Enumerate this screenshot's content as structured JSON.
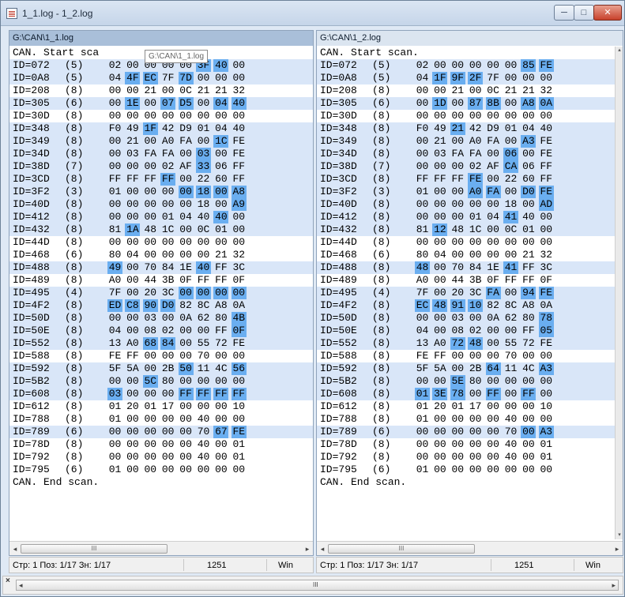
{
  "window": {
    "title": "1_1.log - 1_2.log"
  },
  "window_buttons": {
    "min": "─",
    "max": "□",
    "close": "✕"
  },
  "tooltip": "G:\\CAN\\1_1.log",
  "left": {
    "path": "G:\\CAN\\1_1.log",
    "start": "CAN. Start sca",
    "end": "CAN. End scan.",
    "rows": [
      {
        "id": "ID=072",
        "dlc": "(5)",
        "bytes": [
          "02",
          "00",
          "00",
          "00",
          "00",
          "3F",
          "40",
          "00"
        ],
        "diff": [
          5,
          6
        ],
        "hl": true
      },
      {
        "id": "ID=0A8",
        "dlc": "(5)",
        "bytes": [
          "04",
          "4F",
          "EC",
          "7F",
          "7D",
          "00",
          "00",
          "00"
        ],
        "diff": [
          1,
          2,
          4
        ],
        "hl": true
      },
      {
        "id": "ID=208",
        "dlc": "(8)",
        "bytes": [
          "00",
          "00",
          "21",
          "00",
          "0C",
          "21",
          "21",
          "32"
        ],
        "diff": [],
        "hl": false
      },
      {
        "id": "ID=305",
        "dlc": "(6)",
        "bytes": [
          "00",
          "1E",
          "00",
          "07",
          "D5",
          "00",
          "04",
          "40"
        ],
        "diff": [
          1,
          3,
          4,
          6,
          7
        ],
        "hl": true
      },
      {
        "id": "ID=30D",
        "dlc": "(8)",
        "bytes": [
          "00",
          "00",
          "00",
          "00",
          "00",
          "00",
          "00",
          "00"
        ],
        "diff": [],
        "hl": false
      },
      {
        "id": "ID=348",
        "dlc": "(8)",
        "bytes": [
          "F0",
          "49",
          "1F",
          "42",
          "D9",
          "01",
          "04",
          "40"
        ],
        "diff": [
          2
        ],
        "hl": true
      },
      {
        "id": "ID=349",
        "dlc": "(8)",
        "bytes": [
          "00",
          "21",
          "00",
          "A0",
          "FA",
          "00",
          "1C",
          "FE"
        ],
        "diff": [
          6
        ],
        "hl": true
      },
      {
        "id": "ID=34D",
        "dlc": "(8)",
        "bytes": [
          "00",
          "03",
          "FA",
          "FA",
          "00",
          "03",
          "00",
          "FE"
        ],
        "diff": [
          5
        ],
        "hl": true
      },
      {
        "id": "ID=38D",
        "dlc": "(7)",
        "bytes": [
          "00",
          "00",
          "00",
          "02",
          "AF",
          "33",
          "06",
          "FF"
        ],
        "diff": [
          5
        ],
        "hl": true
      },
      {
        "id": "ID=3CD",
        "dlc": "(8)",
        "bytes": [
          "FF",
          "FF",
          "FF",
          "FF",
          "00",
          "22",
          "60",
          "FF"
        ],
        "diff": [
          3
        ],
        "hl": true
      },
      {
        "id": "ID=3F2",
        "dlc": "(3)",
        "bytes": [
          "01",
          "00",
          "00",
          "00",
          "00",
          "18",
          "00",
          "A8"
        ],
        "diff": [
          4,
          5,
          6,
          7
        ],
        "hl": true
      },
      {
        "id": "ID=40D",
        "dlc": "(8)",
        "bytes": [
          "00",
          "00",
          "00",
          "00",
          "00",
          "18",
          "00",
          "A9"
        ],
        "diff": [
          7
        ],
        "hl": true
      },
      {
        "id": "ID=412",
        "dlc": "(8)",
        "bytes": [
          "00",
          "00",
          "00",
          "01",
          "04",
          "40",
          "40",
          "00"
        ],
        "diff": [
          6
        ],
        "hl": true
      },
      {
        "id": "ID=432",
        "dlc": "(8)",
        "bytes": [
          "81",
          "1A",
          "48",
          "1C",
          "00",
          "0C",
          "01",
          "00"
        ],
        "diff": [
          1
        ],
        "hl": true
      },
      {
        "id": "ID=44D",
        "dlc": "(8)",
        "bytes": [
          "00",
          "00",
          "00",
          "00",
          "00",
          "00",
          "00",
          "00"
        ],
        "diff": [],
        "hl": false
      },
      {
        "id": "ID=468",
        "dlc": "(6)",
        "bytes": [
          "80",
          "04",
          "00",
          "00",
          "00",
          "00",
          "21",
          "32"
        ],
        "diff": [],
        "hl": false
      },
      {
        "id": "ID=488",
        "dlc": "(8)",
        "bytes": [
          "49",
          "00",
          "70",
          "84",
          "1E",
          "40",
          "FF",
          "3C"
        ],
        "diff": [
          0,
          5
        ],
        "hl": true
      },
      {
        "id": "ID=489",
        "dlc": "(8)",
        "bytes": [
          "A0",
          "00",
          "44",
          "3B",
          "0F",
          "FF",
          "FF",
          "0F"
        ],
        "diff": [],
        "hl": false
      },
      {
        "id": "ID=495",
        "dlc": "(4)",
        "bytes": [
          "7F",
          "00",
          "20",
          "3C",
          "00",
          "00",
          "00",
          "00"
        ],
        "diff": [
          4,
          5,
          6,
          7
        ],
        "hl": true
      },
      {
        "id": "ID=4F2",
        "dlc": "(8)",
        "bytes": [
          "ED",
          "C8",
          "90",
          "D0",
          "82",
          "8C",
          "A8",
          "0A"
        ],
        "diff": [
          0,
          1,
          2,
          3
        ],
        "hl": true
      },
      {
        "id": "ID=50D",
        "dlc": "(8)",
        "bytes": [
          "00",
          "00",
          "03",
          "00",
          "0A",
          "62",
          "80",
          "4B"
        ],
        "diff": [
          7
        ],
        "hl": true
      },
      {
        "id": "ID=50E",
        "dlc": "(8)",
        "bytes": [
          "04",
          "00",
          "08",
          "02",
          "00",
          "00",
          "FF",
          "0F"
        ],
        "diff": [
          7
        ],
        "hl": true
      },
      {
        "id": "ID=552",
        "dlc": "(8)",
        "bytes": [
          "13",
          "A0",
          "68",
          "84",
          "00",
          "55",
          "72",
          "FE"
        ],
        "diff": [
          2,
          3
        ],
        "hl": true
      },
      {
        "id": "ID=588",
        "dlc": "(8)",
        "bytes": [
          "FE",
          "FF",
          "00",
          "00",
          "00",
          "70",
          "00",
          "00"
        ],
        "diff": [],
        "hl": false
      },
      {
        "id": "ID=592",
        "dlc": "(8)",
        "bytes": [
          "5F",
          "5A",
          "00",
          "2B",
          "50",
          "11",
          "4C",
          "56"
        ],
        "diff": [
          4,
          7
        ],
        "hl": true
      },
      {
        "id": "ID=5B2",
        "dlc": "(8)",
        "bytes": [
          "00",
          "00",
          "5C",
          "80",
          "00",
          "00",
          "00",
          "00"
        ],
        "diff": [
          2
        ],
        "hl": true
      },
      {
        "id": "ID=608",
        "dlc": "(8)",
        "bytes": [
          "03",
          "00",
          "00",
          "00",
          "FF",
          "FF",
          "FF",
          "FF"
        ],
        "diff": [
          0,
          4,
          5,
          6,
          7
        ],
        "hl": true
      },
      {
        "id": "ID=612",
        "dlc": "(8)",
        "bytes": [
          "01",
          "20",
          "01",
          "17",
          "00",
          "00",
          "00",
          "10"
        ],
        "diff": [],
        "hl": false
      },
      {
        "id": "ID=788",
        "dlc": "(8)",
        "bytes": [
          "01",
          "00",
          "00",
          "00",
          "00",
          "40",
          "00",
          "00"
        ],
        "diff": [],
        "hl": false
      },
      {
        "id": "ID=789",
        "dlc": "(6)",
        "bytes": [
          "00",
          "00",
          "00",
          "00",
          "00",
          "70",
          "67",
          "FE"
        ],
        "diff": [
          6,
          7
        ],
        "hl": true
      },
      {
        "id": "ID=78D",
        "dlc": "(8)",
        "bytes": [
          "00",
          "00",
          "00",
          "00",
          "00",
          "40",
          "00",
          "01"
        ],
        "diff": [],
        "hl": false
      },
      {
        "id": "ID=792",
        "dlc": "(8)",
        "bytes": [
          "00",
          "00",
          "00",
          "00",
          "00",
          "40",
          "00",
          "01"
        ],
        "diff": [],
        "hl": false
      },
      {
        "id": "ID=795",
        "dlc": "(6)",
        "bytes": [
          "01",
          "00",
          "00",
          "00",
          "00",
          "00",
          "00",
          "00"
        ],
        "diff": [],
        "hl": false
      }
    ],
    "status": {
      "pos": "Стр: 1  Поз: 1/17  Зн: 1/17",
      "size": "1251",
      "enc": "Win"
    }
  },
  "right": {
    "path": "G:\\CAN\\1_2.log",
    "start": "CAN. Start scan.",
    "end": "CAN. End scan.",
    "rows": [
      {
        "id": "ID=072",
        "dlc": "(5)",
        "bytes": [
          "02",
          "00",
          "00",
          "00",
          "00",
          "00",
          "85",
          "FE"
        ],
        "diff": [
          6,
          7
        ],
        "hl": true
      },
      {
        "id": "ID=0A8",
        "dlc": "(5)",
        "bytes": [
          "04",
          "1F",
          "9F",
          "2F",
          "7F",
          "00",
          "00",
          "00"
        ],
        "diff": [
          1,
          2,
          3
        ],
        "hl": true
      },
      {
        "id": "ID=208",
        "dlc": "(8)",
        "bytes": [
          "00",
          "00",
          "21",
          "00",
          "0C",
          "21",
          "21",
          "32"
        ],
        "diff": [],
        "hl": false
      },
      {
        "id": "ID=305",
        "dlc": "(6)",
        "bytes": [
          "00",
          "1D",
          "00",
          "87",
          "8B",
          "00",
          "A8",
          "0A"
        ],
        "diff": [
          1,
          3,
          4,
          6,
          7
        ],
        "hl": true
      },
      {
        "id": "ID=30D",
        "dlc": "(8)",
        "bytes": [
          "00",
          "00",
          "00",
          "00",
          "00",
          "00",
          "00",
          "00"
        ],
        "diff": [],
        "hl": false
      },
      {
        "id": "ID=348",
        "dlc": "(8)",
        "bytes": [
          "F0",
          "49",
          "21",
          "42",
          "D9",
          "01",
          "04",
          "40"
        ],
        "diff": [
          2
        ],
        "hl": true
      },
      {
        "id": "ID=349",
        "dlc": "(8)",
        "bytes": [
          "00",
          "21",
          "00",
          "A0",
          "FA",
          "00",
          "A3",
          "FE"
        ],
        "diff": [
          6
        ],
        "hl": true
      },
      {
        "id": "ID=34D",
        "dlc": "(8)",
        "bytes": [
          "00",
          "03",
          "FA",
          "FA",
          "00",
          "06",
          "00",
          "FE"
        ],
        "diff": [
          5
        ],
        "hl": true
      },
      {
        "id": "ID=38D",
        "dlc": "(7)",
        "bytes": [
          "00",
          "00",
          "00",
          "02",
          "AF",
          "CA",
          "06",
          "FF"
        ],
        "diff": [
          5
        ],
        "hl": true
      },
      {
        "id": "ID=3CD",
        "dlc": "(8)",
        "bytes": [
          "FF",
          "FF",
          "FF",
          "FE",
          "00",
          "22",
          "60",
          "FF"
        ],
        "diff": [
          3
        ],
        "hl": true
      },
      {
        "id": "ID=3F2",
        "dlc": "(3)",
        "bytes": [
          "01",
          "00",
          "00",
          "A0",
          "FA",
          "00",
          "D0",
          "FE"
        ],
        "diff": [
          3,
          4,
          6,
          7
        ],
        "hl": true
      },
      {
        "id": "ID=40D",
        "dlc": "(8)",
        "bytes": [
          "00",
          "00",
          "00",
          "00",
          "00",
          "18",
          "00",
          "AD"
        ],
        "diff": [
          7
        ],
        "hl": true
      },
      {
        "id": "ID=412",
        "dlc": "(8)",
        "bytes": [
          "00",
          "00",
          "00",
          "01",
          "04",
          "41",
          "40",
          "00"
        ],
        "diff": [
          5
        ],
        "hl": true
      },
      {
        "id": "ID=432",
        "dlc": "(8)",
        "bytes": [
          "81",
          "12",
          "48",
          "1C",
          "00",
          "0C",
          "01",
          "00"
        ],
        "diff": [
          1
        ],
        "hl": true
      },
      {
        "id": "ID=44D",
        "dlc": "(8)",
        "bytes": [
          "00",
          "00",
          "00",
          "00",
          "00",
          "00",
          "00",
          "00"
        ],
        "diff": [],
        "hl": false
      },
      {
        "id": "ID=468",
        "dlc": "(6)",
        "bytes": [
          "80",
          "04",
          "00",
          "00",
          "00",
          "00",
          "21",
          "32"
        ],
        "diff": [],
        "hl": false
      },
      {
        "id": "ID=488",
        "dlc": "(8)",
        "bytes": [
          "48",
          "00",
          "70",
          "84",
          "1E",
          "41",
          "FF",
          "3C"
        ],
        "diff": [
          0,
          5
        ],
        "hl": true
      },
      {
        "id": "ID=489",
        "dlc": "(8)",
        "bytes": [
          "A0",
          "00",
          "44",
          "3B",
          "0F",
          "FF",
          "FF",
          "0F"
        ],
        "diff": [],
        "hl": false
      },
      {
        "id": "ID=495",
        "dlc": "(4)",
        "bytes": [
          "7F",
          "00",
          "20",
          "3C",
          "FA",
          "00",
          "94",
          "FE"
        ],
        "diff": [
          4,
          6,
          7
        ],
        "hl": true
      },
      {
        "id": "ID=4F2",
        "dlc": "(8)",
        "bytes": [
          "EC",
          "48",
          "91",
          "10",
          "82",
          "8C",
          "A8",
          "0A"
        ],
        "diff": [
          0,
          1,
          2,
          3
        ],
        "hl": true
      },
      {
        "id": "ID=50D",
        "dlc": "(8)",
        "bytes": [
          "00",
          "00",
          "03",
          "00",
          "0A",
          "62",
          "80",
          "78"
        ],
        "diff": [
          7
        ],
        "hl": true
      },
      {
        "id": "ID=50E",
        "dlc": "(8)",
        "bytes": [
          "04",
          "00",
          "08",
          "02",
          "00",
          "00",
          "FF",
          "05"
        ],
        "diff": [
          7
        ],
        "hl": true
      },
      {
        "id": "ID=552",
        "dlc": "(8)",
        "bytes": [
          "13",
          "A0",
          "72",
          "48",
          "00",
          "55",
          "72",
          "FE"
        ],
        "diff": [
          2,
          3
        ],
        "hl": true
      },
      {
        "id": "ID=588",
        "dlc": "(8)",
        "bytes": [
          "FE",
          "FF",
          "00",
          "00",
          "00",
          "70",
          "00",
          "00"
        ],
        "diff": [],
        "hl": false
      },
      {
        "id": "ID=592",
        "dlc": "(8)",
        "bytes": [
          "5F",
          "5A",
          "00",
          "2B",
          "64",
          "11",
          "4C",
          "A3"
        ],
        "diff": [
          4,
          7
        ],
        "hl": true
      },
      {
        "id": "ID=5B2",
        "dlc": "(8)",
        "bytes": [
          "00",
          "00",
          "5E",
          "80",
          "00",
          "00",
          "00",
          "00"
        ],
        "diff": [
          2
        ],
        "hl": true
      },
      {
        "id": "ID=608",
        "dlc": "(8)",
        "bytes": [
          "01",
          "3E",
          "78",
          "00",
          "FF",
          "00",
          "FF",
          "00"
        ],
        "diff": [
          0,
          1,
          2,
          4,
          6
        ],
        "hl": true
      },
      {
        "id": "ID=612",
        "dlc": "(8)",
        "bytes": [
          "01",
          "20",
          "01",
          "17",
          "00",
          "00",
          "00",
          "10"
        ],
        "diff": [],
        "hl": false
      },
      {
        "id": "ID=788",
        "dlc": "(8)",
        "bytes": [
          "01",
          "00",
          "00",
          "00",
          "00",
          "40",
          "00",
          "00"
        ],
        "diff": [],
        "hl": false
      },
      {
        "id": "ID=789",
        "dlc": "(6)",
        "bytes": [
          "00",
          "00",
          "00",
          "00",
          "00",
          "70",
          "00",
          "A3"
        ],
        "diff": [
          6,
          7
        ],
        "hl": true
      },
      {
        "id": "ID=78D",
        "dlc": "(8)",
        "bytes": [
          "00",
          "00",
          "00",
          "00",
          "00",
          "40",
          "00",
          "01"
        ],
        "diff": [],
        "hl": false
      },
      {
        "id": "ID=792",
        "dlc": "(8)",
        "bytes": [
          "00",
          "00",
          "00",
          "00",
          "00",
          "40",
          "00",
          "01"
        ],
        "diff": [],
        "hl": false
      },
      {
        "id": "ID=795",
        "dlc": "(6)",
        "bytes": [
          "01",
          "00",
          "00",
          "00",
          "00",
          "00",
          "00",
          "00"
        ],
        "diff": [],
        "hl": false
      }
    ],
    "status": {
      "pos": "Стр: 1  Поз: 1/17  Зн: 1/17",
      "size": "1251",
      "enc": "Win"
    }
  },
  "scroll": {
    "left_arrow": "◂",
    "right_arrow": "▸",
    "up_arrow": "▴",
    "down_arrow": "▾",
    "grip": "III",
    "close_x": "×"
  },
  "colors": {
    "diff": "#6aaef0",
    "row_highlight": "#d9e6f8",
    "active_header": "#a9bfd9",
    "inactive_header": "#dbe5f0"
  }
}
